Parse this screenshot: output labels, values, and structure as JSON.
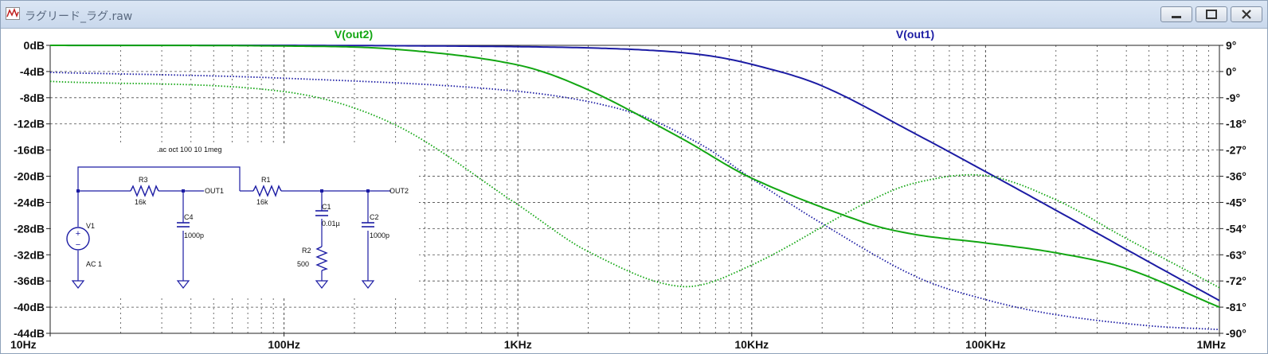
{
  "window": {
    "title": "ラグリード_ラグ.raw",
    "buttons": [
      "minimize",
      "maximize",
      "close"
    ],
    "icon": "waveform-icon"
  },
  "chart_data": {
    "type": "line",
    "x_scale": "log",
    "xlim": [
      10,
      1000000
    ],
    "x_ticks": [
      "10Hz",
      "100Hz",
      "1KHz",
      "10KHz",
      "100KHz",
      "1MHz"
    ],
    "ylim_left": [
      -44,
      0
    ],
    "y_ticks_left": [
      "0dB",
      "-4dB",
      "-8dB",
      "-12dB",
      "-16dB",
      "-20dB",
      "-24dB",
      "-28dB",
      "-32dB",
      "-36dB",
      "-40dB",
      "-44dB"
    ],
    "ylim_right": [
      -90,
      9
    ],
    "y_ticks_right": [
      "9°",
      "0°",
      "-9°",
      "-18°",
      "-27°",
      "-36°",
      "-45°",
      "-54°",
      "-63°",
      "-72°",
      "-81°",
      "-90°"
    ],
    "grid": true,
    "series": [
      {
        "name": "V(out1)",
        "color": "#1c1ca4",
        "x": [
          10,
          100,
          1000,
          3000,
          6000,
          10000,
          20000,
          50000,
          100000,
          200000,
          500000,
          1000000
        ],
        "magnitude_db": [
          0,
          0,
          -0.2,
          -0.6,
          -1.4,
          -2.9,
          -6.2,
          -13.5,
          -19.3,
          -25.2,
          -33.1,
          -39
        ],
        "phase_deg": [
          -0.3,
          -2.3,
          -6.8,
          -13.8,
          -24.9,
          -36.8,
          -52.3,
          -70.4,
          -78.4,
          -83.6,
          -87.4,
          -88.7
        ]
      },
      {
        "name": "V(out2)",
        "color": "#12a612",
        "x": [
          10,
          100,
          300,
          1000,
          2000,
          5000,
          10000,
          30000,
          50000,
          100000,
          200000,
          400000,
          1000000
        ],
        "magnitude_db": [
          0,
          -0.1,
          -0.6,
          -3,
          -6.8,
          -14.2,
          -20.3,
          -27,
          -28.9,
          -30.2,
          -31.7,
          -34.1,
          -40
        ],
        "phase_deg": [
          -3.4,
          -6.9,
          -18.4,
          -45.8,
          -61.9,
          -73.9,
          -66.5,
          -45.6,
          -38.3,
          -35.8,
          -44.1,
          -57.4,
          -74.3
        ]
      }
    ],
    "legend": [
      "V(out2)",
      "V(out1)"
    ],
    "schematic": {
      "directive": ".ac oct 100 10 1meg",
      "components": [
        {
          "ref": "V1",
          "value": "AC 1"
        },
        {
          "ref": "R3",
          "value": "16k"
        },
        {
          "ref": "C4",
          "value": "1000p"
        },
        {
          "ref": "R1",
          "value": "16k"
        },
        {
          "ref": "C1",
          "value": "0.01µ"
        },
        {
          "ref": "R2",
          "value": "500"
        },
        {
          "ref": "C2",
          "value": "1000p"
        }
      ],
      "nets": [
        "OUT1",
        "OUT2"
      ]
    }
  }
}
